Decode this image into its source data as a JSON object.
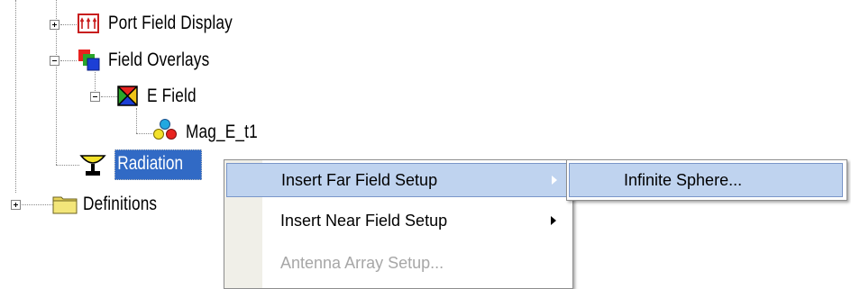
{
  "tree": {
    "nodes": [
      {
        "id": "port_field_display",
        "label": "Port Field Display",
        "icon": "port-field-icon",
        "expander": "plus"
      },
      {
        "id": "field_overlays",
        "label": "Field Overlays",
        "icon": "field-overlays-icon",
        "expander": "minus"
      },
      {
        "id": "e_field",
        "label": "E Field",
        "icon": "e-field-icon",
        "expander": "minus"
      },
      {
        "id": "mag_e_t1",
        "label": "Mag_E_t1",
        "icon": "scalar-plot-icon",
        "expander": "none"
      },
      {
        "id": "radiation",
        "label": "Radiation",
        "icon": "antenna-icon",
        "expander": "none",
        "selected": true
      },
      {
        "id": "definitions",
        "label": "Definitions",
        "icon": "folder-icon",
        "expander": "plus"
      }
    ]
  },
  "context_menu": {
    "items": [
      {
        "label": "Insert Far Field Setup",
        "has_submenu": true,
        "highlighted": true,
        "enabled": true
      },
      {
        "label": "Insert Near Field Setup",
        "has_submenu": true,
        "highlighted": false,
        "enabled": true
      },
      {
        "label": "Antenna Array Setup...",
        "has_submenu": false,
        "highlighted": false,
        "enabled": false
      }
    ]
  },
  "submenu": {
    "items": [
      {
        "label": "Infinite Sphere...",
        "highlighted": true
      }
    ]
  },
  "colors": {
    "selection": "#316ac5",
    "menu_highlight": "#bfd3ef",
    "menu_gutter": "#f0efe8",
    "disabled_text": "#a7a7a7"
  }
}
